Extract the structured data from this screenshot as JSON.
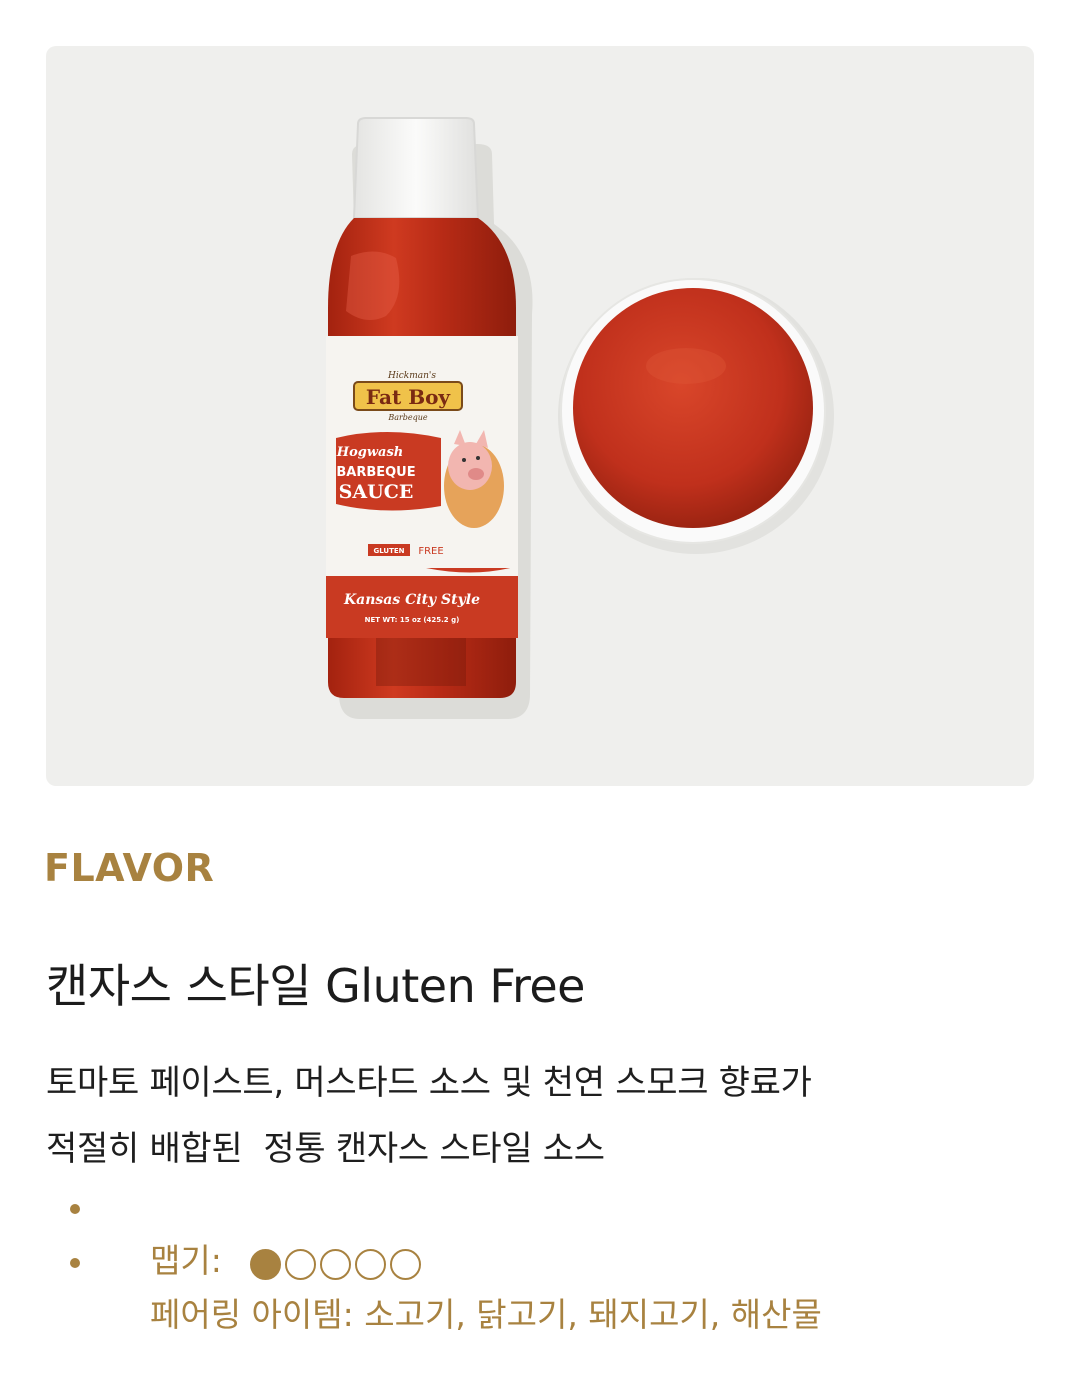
{
  "hero": {
    "brand_small": "Hickman's",
    "brand_main": "Fat Boy",
    "brand_sub": "Barbeque",
    "script_name": "Hogwash",
    "line1": "BARBEQUE",
    "line2": "SAUCE",
    "gluten": "GLUTEN",
    "free": "FREE",
    "style": "Kansas City Style",
    "net_weight": "NET WT: 15 oz (425.2 g)"
  },
  "section_label": "FLAVOR",
  "product_title": "캔자스 스타일 Gluten Free",
  "description": {
    "line1": "토마토 페이스트, 머스타드 소스 및 천연 스모크 향료가",
    "line2": "적절히 배합된  정통 캔자스 스타일 소스"
  },
  "specs": {
    "spice_label": "맵기: ",
    "spice_level": 1,
    "spice_max": 5,
    "pairing_label": "페어링 아이템: ",
    "pairing_value": "소고기, 닭고기, 돼지고기, 해산물"
  },
  "colors": {
    "accent": "#a88240",
    "sauce": "#c8321e",
    "text": "#1c1c1c"
  }
}
